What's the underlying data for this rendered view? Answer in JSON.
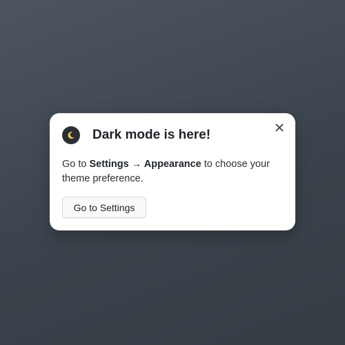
{
  "dialog": {
    "title": "Dark mode is here!",
    "icon": "moon-icon",
    "close_icon": "close-icon",
    "message": {
      "prefix": "Go to ",
      "settings": "Settings",
      "arrow": " → ",
      "appearance": "Appearance",
      "suffix": " to choose your theme preference."
    },
    "button_label": "Go to Settings"
  },
  "colors": {
    "background": "#3f4750",
    "card": "#ffffff",
    "icon_badge": "#2a2f36",
    "moon": "#f2c94c",
    "text": "#1e2329"
  }
}
